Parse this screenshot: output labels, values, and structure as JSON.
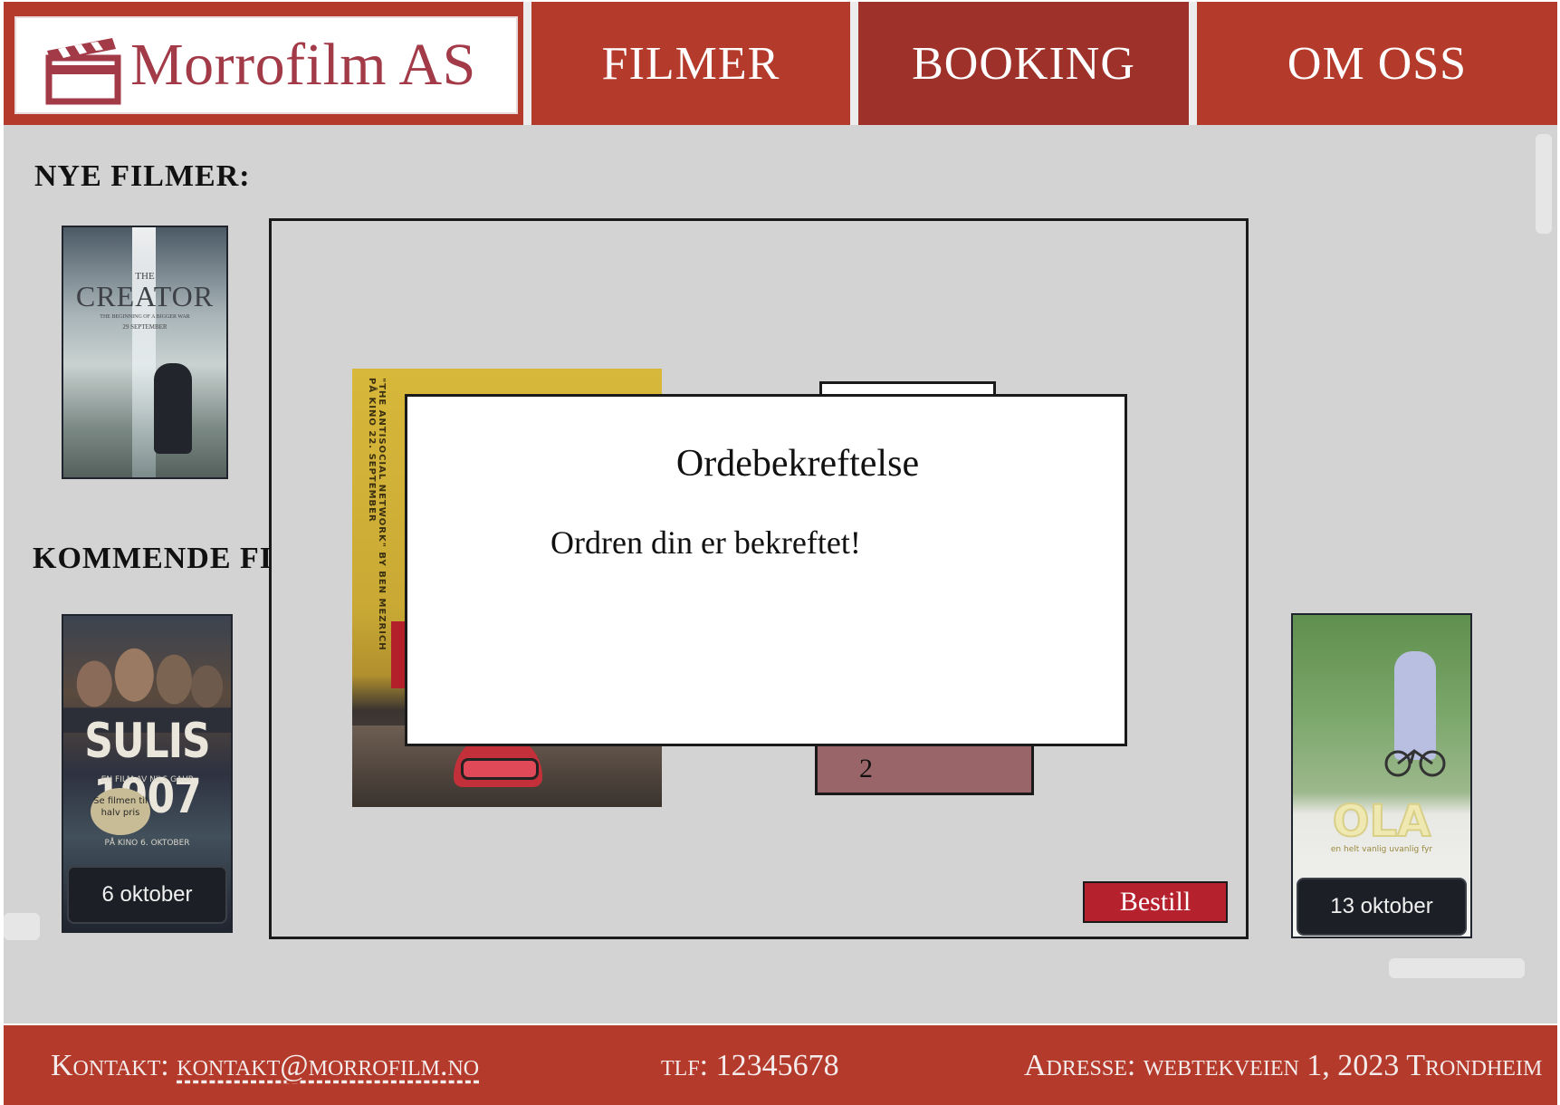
{
  "brand": {
    "name": "Morrofilm AS",
    "logo_icon": "clapperboard-icon"
  },
  "nav": {
    "items": [
      {
        "label": "FILMER",
        "active": false
      },
      {
        "label": "BOOKING",
        "active": true
      },
      {
        "label": "OM OSS",
        "active": false
      }
    ]
  },
  "sections": {
    "new_title": "NYE FILMER:",
    "upcoming_title": "KOMMENDE FIL"
  },
  "posters": {
    "creator": {
      "small_the": "THE",
      "title": "CREATOR",
      "tagline": "THE BEGINNING OF A BIGGER WAR",
      "date": "29 SEPTEMBER"
    },
    "sulis": {
      "title": "SULIS 1907",
      "director": "EN FILM AV NILS GAUP",
      "badge": "Se filmen til halv pris",
      "release": "PÅ KINO 6. OKTOBER",
      "date_label": "6 oktober"
    },
    "ola": {
      "title": "OLA",
      "tagline": "en helt vanlig uvanlig fyr",
      "date_label": "13 oktober"
    },
    "social_network": {
      "spine_text": "\"THE ANTISOCIAL NETWORK\" BY BEN MEZRICH  PÅ KINO 22. SEPTEMBER"
    }
  },
  "booking": {
    "quantity": "2",
    "order_button": "Bestill"
  },
  "modal": {
    "title": "Ordebekreftelse",
    "message": "Ordren din er bekreftet!"
  },
  "footer": {
    "contact_label": "Kontakt:",
    "contact_email": "kontakt@morrofilm.no",
    "phone": "tlf: 12345678",
    "address": "Adresse: webtekveien 1, 2023 Trondheim"
  },
  "colors": {
    "brand_red": "#b43a2b",
    "active_nav": "#9e322b",
    "button_red": "#b5222d",
    "logo_text": "#a33a48",
    "background_grey": "#d3d3d3"
  }
}
